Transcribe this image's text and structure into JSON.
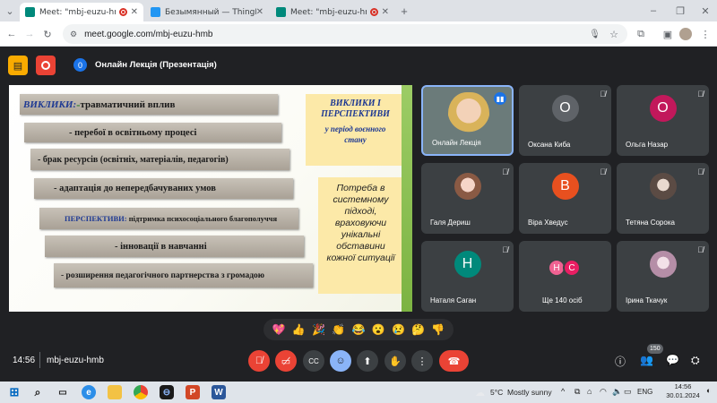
{
  "browser": {
    "tabs": [
      {
        "title": "Meet: \"mbj-euzu-hmb\"",
        "active": true
      },
      {
        "title": "Безымянный — ThingLink",
        "active": false
      },
      {
        "title": "Meet: \"mbj-euzu-hmb\"",
        "active": false
      }
    ],
    "new_tab": "+",
    "url": "meet.google.com/mbj-euzu-hmb"
  },
  "meet": {
    "presenter_badge": "0",
    "title": "Онлайн Лекція (Презентація)",
    "time": "14:56",
    "code": "mbj-euzu-hmb",
    "participants_count": "150"
  },
  "slide": {
    "lines": [
      {
        "lead": "ВИКЛИКИ:",
        "dash": " - ",
        "text": "травматичний вплив"
      },
      {
        "text": "- перебої в освітньому процесі"
      },
      {
        "text": "- брак ресурсів (освітніх, матеріалів, педагогів)"
      },
      {
        "text": "- адаптація до непередбачуваних умов"
      },
      {
        "lead": "ПЕРСПЕКТИВИ:",
        "text": "підтримка психосоціального благополуччя"
      },
      {
        "text": "- інновації в навчанні"
      },
      {
        "text": "- розширення педагогічного партнерства з громадою"
      }
    ],
    "title_box": {
      "line1": "ВИКЛИКИ І",
      "line2": "ПЕРСПЕКТИВИ",
      "line3": "у період воєнного",
      "line4": "стану"
    },
    "need_box": "Потреба в системному підході, враховуючи унікальні обставини кожної ситуації"
  },
  "participants": [
    {
      "name": "Онлайн Лекція",
      "kind": "video",
      "speaking": true
    },
    {
      "name": "Оксана Киба",
      "initial": "О",
      "color": "#5f6368"
    },
    {
      "name": "Ольга Назар",
      "initial": "О",
      "color": "#c2185b"
    },
    {
      "name": "Галя Дериш",
      "kind": "photo",
      "color": "#e8b4b8"
    },
    {
      "name": "Віра Хведус",
      "initial": "В",
      "color": "#e8501f"
    },
    {
      "name": "Тетяна Сорока",
      "kind": "photo",
      "color": "#9aa5b1"
    },
    {
      "name": "Наталя Саган",
      "initial": "Н",
      "color": "#00897b"
    },
    {
      "name": "Ще 140 осіб",
      "initials": [
        "Н",
        "С"
      ]
    },
    {
      "name": "Ірина Ткачук",
      "kind": "photo",
      "color": "#c9b8c8"
    }
  ],
  "reactions": [
    "💖",
    "👍",
    "🎉",
    "👏",
    "😂",
    "😮",
    "😢",
    "🤔",
    "👎"
  ],
  "taskbar": {
    "weather": "5°C  Mostly sunny",
    "lang": "ENG",
    "time": "14:56",
    "date": "30.01.2024"
  }
}
